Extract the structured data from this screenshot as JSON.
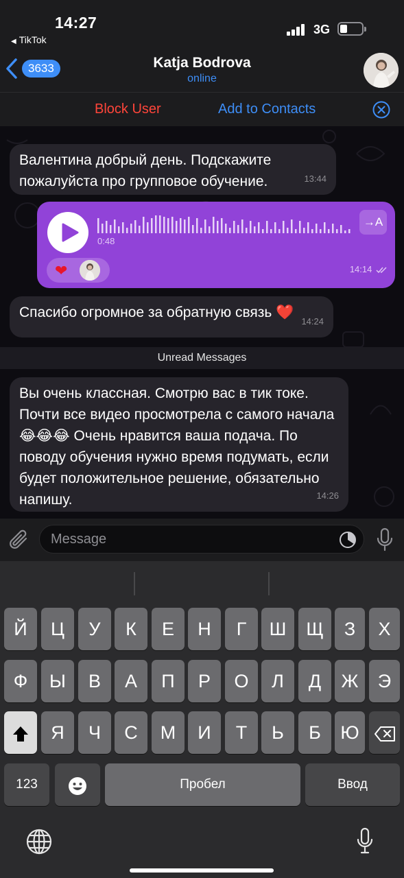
{
  "status_bar": {
    "time": "14:27",
    "back_app": "TikTok",
    "network": "3G"
  },
  "header": {
    "back_badge": "3633",
    "peer_name": "Katja Bodrova",
    "peer_status": "online"
  },
  "actions": {
    "block": "Block User",
    "add": "Add to Contacts"
  },
  "messages": [
    {
      "text": "Валентина добрый день. Подскажите пожалуйста про групповое обучение.",
      "time": "13:44"
    },
    {
      "type": "voice",
      "duration": "0:48",
      "transcribe": "→A",
      "reaction": "❤",
      "time": "14:14",
      "status": "read"
    },
    {
      "text": "Спасибо огромное за обратную связь ❤️",
      "time": "14:24"
    },
    {
      "text": "Вы очень классная. Смотрю вас в тик токе. Почти все видео просмотрела с самого начала 😂😂😂 Очень нравится ваша подача. По поводу обучения нужно время подумать, если будет положительное решение, обязательно напишу.",
      "time": "14:26"
    }
  ],
  "unread_divider": "Unread Messages",
  "input": {
    "placeholder": "Message"
  },
  "keyboard": {
    "row1": [
      "Й",
      "Ц",
      "У",
      "К",
      "Е",
      "Н",
      "Г",
      "Ш",
      "Щ",
      "З",
      "Х"
    ],
    "row2": [
      "Ф",
      "Ы",
      "В",
      "А",
      "П",
      "Р",
      "О",
      "Л",
      "Д",
      "Ж",
      "Э"
    ],
    "row3": [
      "Я",
      "Ч",
      "С",
      "М",
      "И",
      "Т",
      "Ь",
      "Б",
      "Ю"
    ],
    "numbers": "123",
    "space": "Пробел",
    "enter": "Ввод"
  },
  "colors": {
    "accent": "#3e8ef7",
    "danger": "#ff453a",
    "outgoing": "#9143d8",
    "incoming": "#26242b"
  }
}
